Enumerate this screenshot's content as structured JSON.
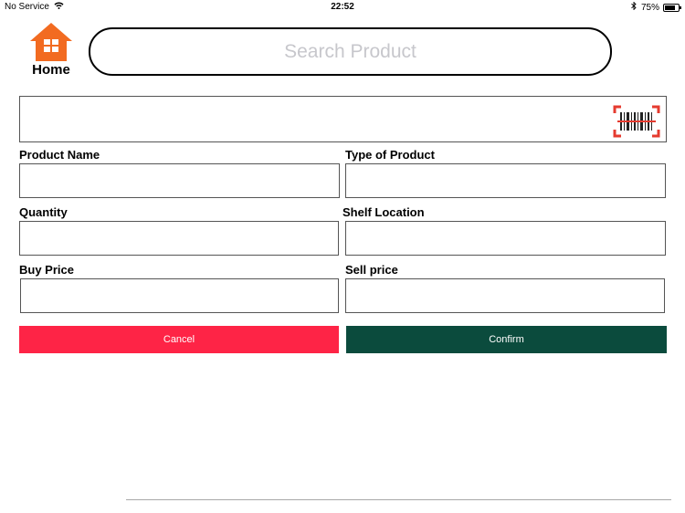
{
  "status_bar": {
    "carrier": "No Service",
    "time": "22:52",
    "battery_percent": "75%",
    "battery_level": 0.75,
    "icons": [
      "wifi-icon",
      "bluetooth-icon",
      "battery-icon"
    ]
  },
  "home": {
    "label": "Home",
    "icon": "home-icon",
    "icon_color": "#f26b21"
  },
  "search": {
    "placeholder": "Search Product",
    "value": ""
  },
  "barcode": {
    "value": "",
    "scan_icon": "barcode-scan-icon",
    "scan_color": "#e53b2f"
  },
  "form": {
    "product_name": {
      "label": "Product Name",
      "value": ""
    },
    "type_of_product": {
      "label": "Type of Product",
      "value": ""
    },
    "quantity": {
      "label": "Quantity",
      "value": ""
    },
    "shelf_location": {
      "label": "Shelf Location",
      "value": ""
    },
    "buy_price": {
      "label": "Buy Price",
      "value": ""
    },
    "sell_price": {
      "label": "Sell price",
      "value": ""
    }
  },
  "actions": {
    "cancel_label": "Cancel",
    "cancel_color": "#fe2446",
    "confirm_label": "Confirm",
    "confirm_color": "#0b4b3d"
  }
}
